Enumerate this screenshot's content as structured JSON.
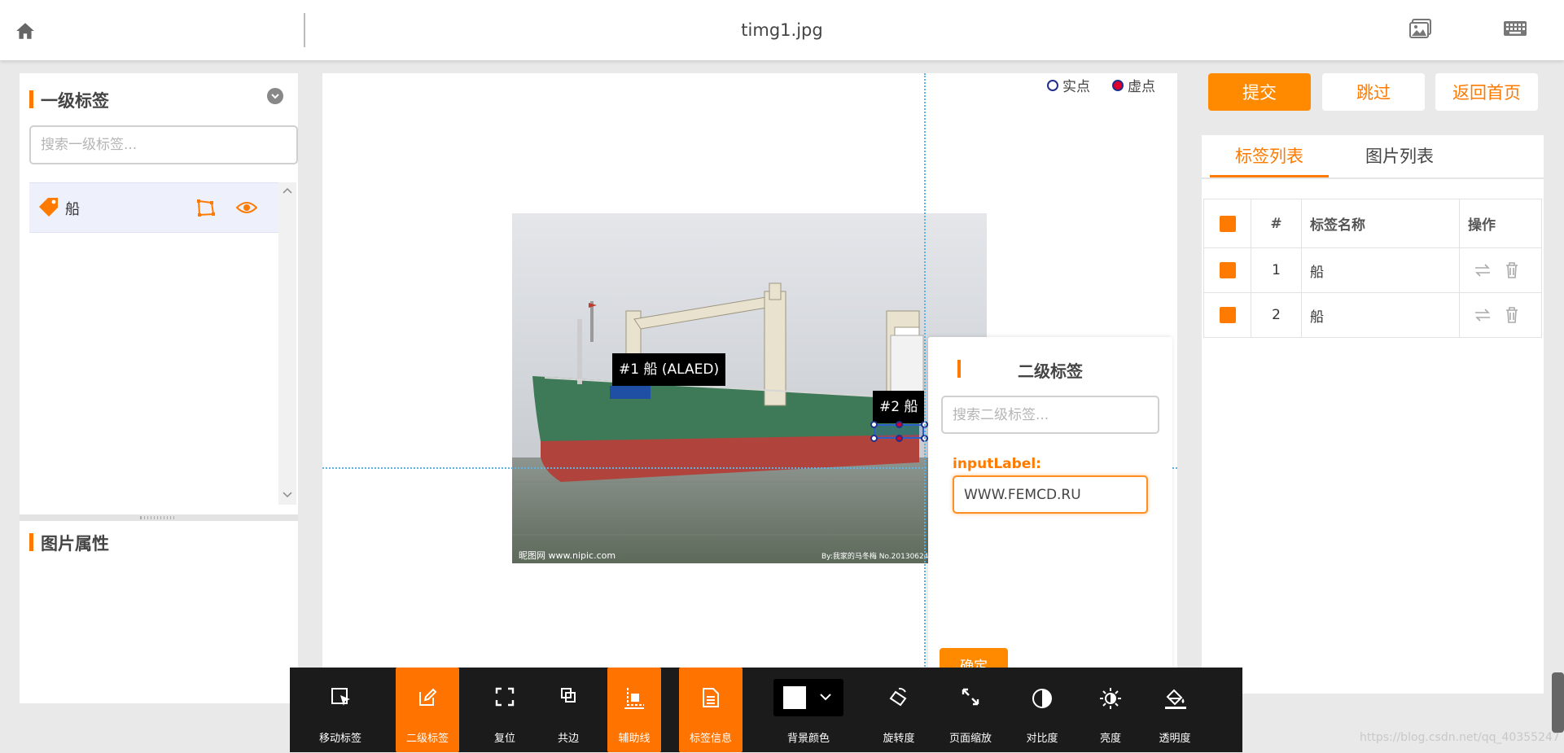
{
  "header": {
    "file_title": "timg1.jpg"
  },
  "primary_labels": {
    "title": "一级标签",
    "search_placeholder": "搜索一级标签...",
    "items": [
      {
        "label": "船"
      }
    ]
  },
  "image_properties": {
    "title": "图片属性"
  },
  "canvas": {
    "legend_solid_point": "实点",
    "legend_virtual_point": "虚点",
    "annotations": [
      {
        "tag": "#1 船 (ALAED)"
      },
      {
        "tag": "#2 船"
      }
    ],
    "image_watermark_left": "昵图网 www.nipic.com",
    "image_watermark_right": "By:我家的马冬梅 No.20130624"
  },
  "secondary_popup": {
    "title": "二级标签",
    "search_placeholder": "搜索二级标签...",
    "input_label": "inputLabel:",
    "input_value": "WWW.FEMCD.RU",
    "confirm_label": "确定"
  },
  "actions": {
    "submit": "提交",
    "skip": "跳过",
    "back_home": "返回首页"
  },
  "right_panel": {
    "tabs": [
      {
        "label": "标签列表",
        "active": true
      },
      {
        "label": "图片列表",
        "active": false
      }
    ],
    "table": {
      "columns": [
        "#",
        "标签名称",
        "操作"
      ],
      "rows": [
        {
          "index": "1",
          "name": "船"
        },
        {
          "index": "2",
          "name": "船"
        }
      ]
    }
  },
  "toolbar": {
    "tools": [
      {
        "label": "移动标签",
        "active": false
      },
      {
        "label": "二级标签",
        "active": true
      },
      {
        "label": "复位",
        "active": false
      },
      {
        "label": "共边",
        "active": false
      },
      {
        "label": "辅助线",
        "active": true
      },
      {
        "label": "标签信息",
        "active": true
      },
      {
        "label": "背景颜色",
        "active": false
      },
      {
        "label": "旋转度",
        "active": false
      },
      {
        "label": "页面缩放",
        "active": false
      },
      {
        "label": "对比度",
        "active": false
      },
      {
        "label": "亮度",
        "active": false
      },
      {
        "label": "透明度",
        "active": false
      }
    ],
    "background_color": "#ffffff"
  },
  "theme": {
    "accent": "#ff7a00"
  },
  "footer": {
    "watermark": "https://blog.csdn.net/qq_40355247"
  }
}
